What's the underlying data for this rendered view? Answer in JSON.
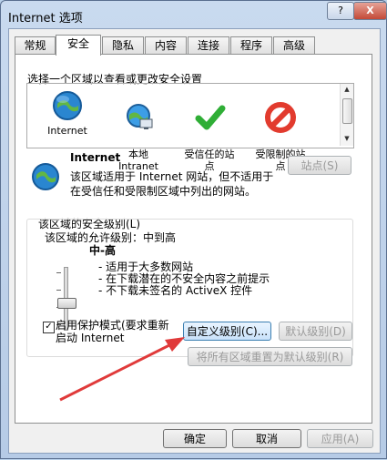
{
  "window": {
    "title": "Internet 选项",
    "help_label": "?",
    "close_label": "X"
  },
  "tabs": [
    "常规",
    "安全",
    "隐私",
    "内容",
    "连接",
    "程序",
    "高级"
  ],
  "security": {
    "zone_prompt": "选择一个区域以查看或更改安全设置",
    "zones": [
      {
        "name": "Internet",
        "icon": "globe-icon"
      },
      {
        "name": "本地\nIntranet",
        "icon": "computer-network-icon"
      },
      {
        "name": "受信任的站\n点",
        "icon": "green-check-icon"
      },
      {
        "name": "受限制的站\n点",
        "icon": "red-forbidden-icon"
      }
    ],
    "selected_zone_title": "Internet",
    "zone_description": "该区域适用于 Internet 网站，但不适用于\n在受信任和受限制区域中列出的网站。",
    "sites_button": "站点(S)",
    "security_level_title": "该区域的安全级别(L)",
    "allowed_levels": "该区域的允许级别：中到高",
    "level_name": "中-高",
    "level_bullets": [
      "- 适用于大多数网站",
      "- 在下载潜在的不安全内容之前提示",
      "- 不下载未签名的 ActiveX 控件"
    ],
    "protected_mode_checkbox": {
      "label": "启用保护模式(要求重新\n启动 Internet",
      "checked": true
    },
    "custom_level_button": "自定义级别(C)...",
    "default_level_button": "默认级别(D)",
    "reset_all_button": "将所有区域重置为默认级别(R)"
  },
  "footer": {
    "ok_button": "确定",
    "cancel_button": "取消",
    "apply_button": "应用(A)"
  },
  "colors": {
    "accent": "#5f80b8",
    "window_frame": "#b9d1ea",
    "arrow": "#e03a3a"
  }
}
